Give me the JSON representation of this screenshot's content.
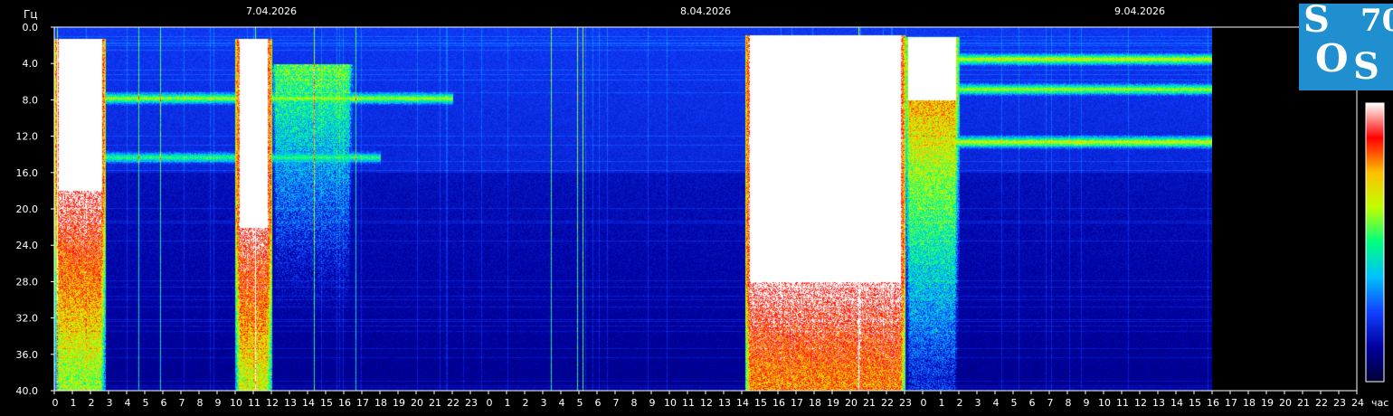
{
  "chart_data": {
    "type": "heatmap",
    "y_unit_label": "Гц",
    "x_unit_label": "час",
    "y_ticks": [
      "0.0",
      "4.0",
      "8.0",
      "12.0",
      "16.0",
      "20.0",
      "24.0",
      "28.0",
      "32.0",
      "36.0",
      "40.0"
    ],
    "ylim": [
      0,
      40
    ],
    "x_ticks": [
      "0",
      "1",
      "2",
      "3",
      "4",
      "5",
      "6",
      "7",
      "8",
      "9",
      "10",
      "11",
      "12",
      "13",
      "14",
      "15",
      "16",
      "17",
      "18",
      "19",
      "20",
      "21",
      "22",
      "23",
      "0",
      "1",
      "2",
      "3",
      "4",
      "5",
      "6",
      "7",
      "8",
      "9",
      "10",
      "11",
      "12",
      "13",
      "14",
      "15",
      "16",
      "17",
      "18",
      "19",
      "20",
      "21",
      "22",
      "23",
      "0",
      "1",
      "2",
      "3",
      "4",
      "5",
      "6",
      "7",
      "8",
      "9",
      "10",
      "11",
      "12",
      "13",
      "14",
      "15",
      "16",
      "17",
      "18",
      "19",
      "20",
      "21",
      "22",
      "23",
      "24"
    ],
    "date_labels": [
      {
        "text": "7.04.2026",
        "hour": 12
      },
      {
        "text": "8.04.2026",
        "hour": 36
      },
      {
        "text": "9.04.2026",
        "hour": 60
      }
    ],
    "data_end_hour": 64,
    "xlim": [
      0,
      72
    ],
    "colormap": [
      "#000033",
      "#0000a0",
      "#1040ff",
      "#00c0ff",
      "#00ff80",
      "#c0ff00",
      "#ffc000",
      "#ff0000",
      "#ffffff"
    ],
    "bursts": [
      {
        "x0": 0.0,
        "x1": 2.8,
        "ytop": 1.2,
        "intensity": 0.97,
        "solid_until_hz": 18
      },
      {
        "x0": 10.0,
        "x1": 12.0,
        "ytop": 1.2,
        "intensity": 0.95,
        "solid_until_hz": 22
      },
      {
        "x0": 12.0,
        "x1": 16.5,
        "ytop": 4.0,
        "intensity": 0.62,
        "solid_until_hz": 0
      },
      {
        "x0": 38.2,
        "x1": 47.0,
        "ytop": 0.8,
        "intensity": 0.98,
        "solid_until_hz": 28
      },
      {
        "x0": 47.0,
        "x1": 50.0,
        "ytop": 1.0,
        "intensity": 0.75,
        "solid_until_hz": 8
      }
    ],
    "bands": [
      {
        "hz": 7.8,
        "x0": 2.8,
        "x1": 22,
        "intensity": 0.55
      },
      {
        "hz": 14.3,
        "x0": 2.8,
        "x1": 18,
        "intensity": 0.45
      },
      {
        "hz": 12.6,
        "x0": 48,
        "x1": 64,
        "intensity": 0.6
      },
      {
        "hz": 3.5,
        "x0": 48,
        "x1": 64,
        "intensity": 0.6
      },
      {
        "hz": 6.8,
        "x0": 48,
        "x1": 64,
        "intensity": 0.55
      }
    ],
    "logo_text": {
      "s1": "S",
      "o": "O",
      "s2": "S",
      "num": "70"
    }
  }
}
